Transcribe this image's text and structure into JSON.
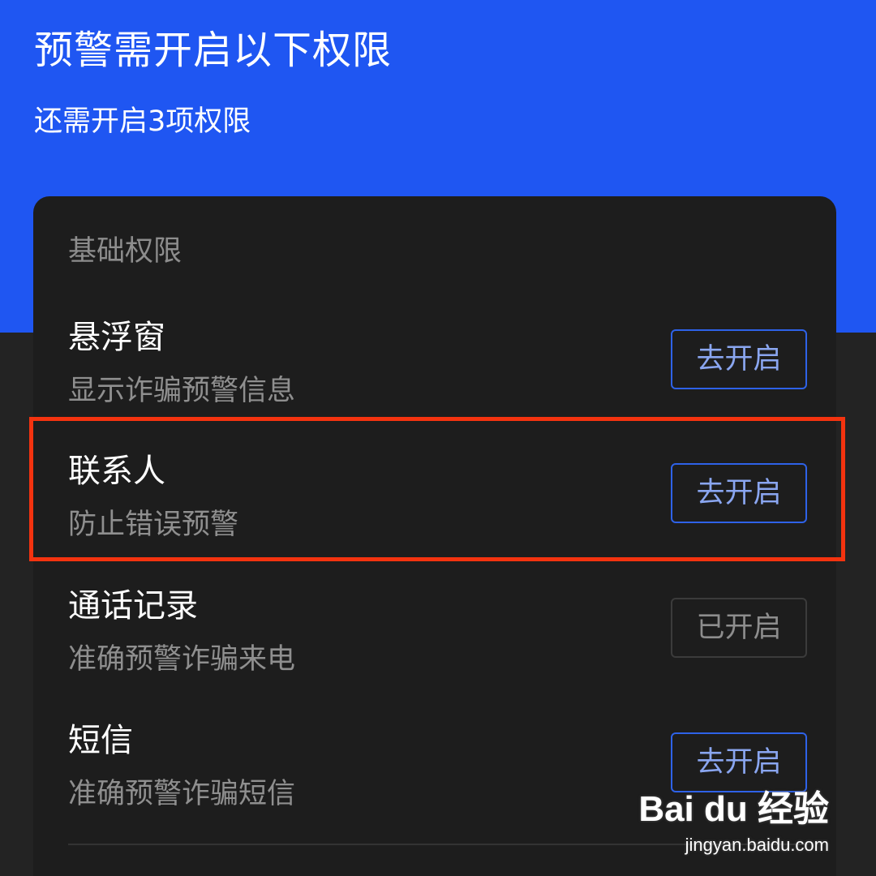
{
  "header": {
    "title": "预警需开启以下权限",
    "subtitle": "还需开启3项权限",
    "background_color": "#1f56f2"
  },
  "card": {
    "section_label": "基础权限",
    "rows": [
      {
        "title": "悬浮窗",
        "description": "显示诈骗预警信息",
        "button_label": "去开启",
        "enabled": false
      },
      {
        "title": "联系人",
        "description": "防止错误预警",
        "button_label": "去开启",
        "enabled": false,
        "highlighted": true
      },
      {
        "title": "通话记录",
        "description": "准确预警诈骗来电",
        "button_label": "已开启",
        "enabled": true
      },
      {
        "title": "短信",
        "description": "准确预警诈骗短信",
        "button_label": "去开启",
        "enabled": false
      }
    ]
  },
  "highlight_color": "#f4330f",
  "watermark": {
    "logo": "Bai du 经验",
    "url": "jingyan.baidu.com"
  }
}
